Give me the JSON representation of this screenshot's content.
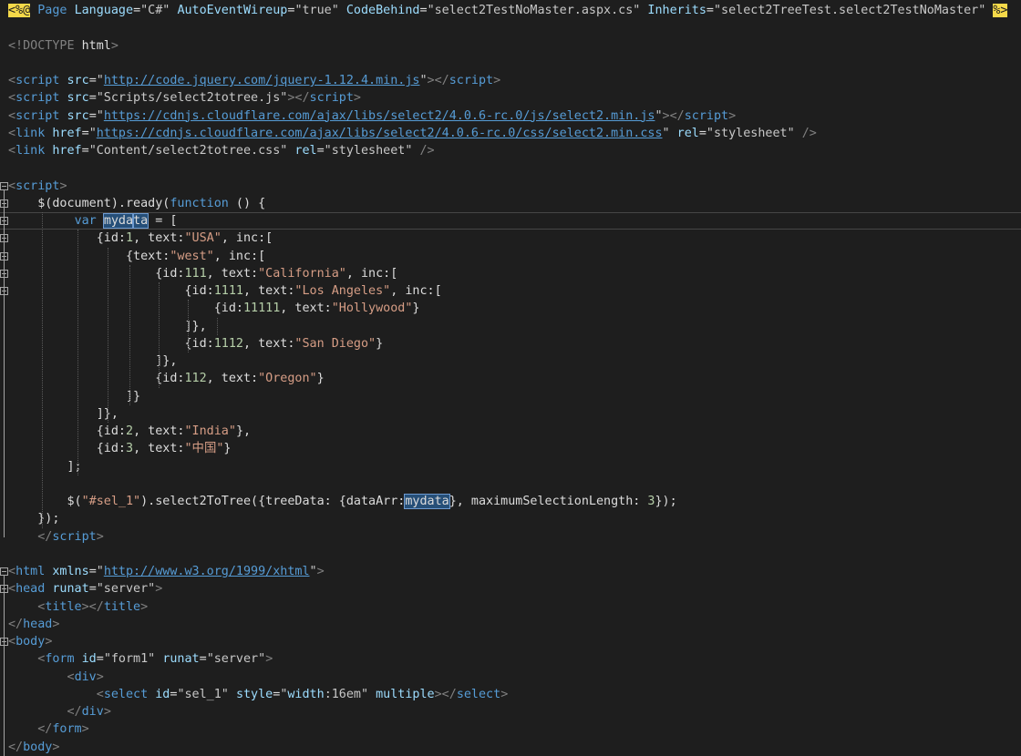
{
  "editor": {
    "lines": [
      [
        [
          "dir",
          "<%@"
        ],
        [
          "txt",
          " "
        ],
        [
          "tag",
          "Page"
        ],
        [
          "txt",
          " "
        ],
        [
          "attr",
          "Language"
        ],
        [
          "txt",
          "="
        ],
        [
          "val",
          "\"C#\""
        ],
        [
          "txt",
          " "
        ],
        [
          "attr",
          "AutoEventWireup"
        ],
        [
          "txt",
          "="
        ],
        [
          "val",
          "\"true\""
        ],
        [
          "txt",
          " "
        ],
        [
          "attr",
          "CodeBehind"
        ],
        [
          "txt",
          "="
        ],
        [
          "val",
          "\"select2TestNoMaster.aspx.cs\""
        ],
        [
          "txt",
          " "
        ],
        [
          "attr",
          "Inherits"
        ],
        [
          "txt",
          "="
        ],
        [
          "val",
          "\"select2TreeTest.select2TestNoMaster\""
        ],
        [
          "txt",
          " "
        ],
        [
          "dir",
          "%>"
        ]
      ],
      [],
      [
        [
          "delim",
          "<!"
        ],
        [
          "doc",
          "DOCTYPE"
        ],
        [
          "txt",
          " "
        ],
        [
          "html",
          "html"
        ],
        [
          "delim",
          ">"
        ]
      ],
      [],
      [
        [
          "delim",
          "<"
        ],
        [
          "tag",
          "script"
        ],
        [
          "txt",
          " "
        ],
        [
          "attr",
          "src"
        ],
        [
          "txt",
          "="
        ],
        [
          "val",
          "\""
        ],
        [
          "url",
          "http://code.jquery.com/jquery-1.12.4.min.js"
        ],
        [
          "val",
          "\""
        ],
        [
          "delim",
          "></"
        ],
        [
          "tag",
          "script"
        ],
        [
          "delim",
          ">"
        ]
      ],
      [
        [
          "delim",
          "<"
        ],
        [
          "tag",
          "script"
        ],
        [
          "txt",
          " "
        ],
        [
          "attr",
          "src"
        ],
        [
          "txt",
          "="
        ],
        [
          "val",
          "\"Scripts/select2totree.js\""
        ],
        [
          "delim",
          "></"
        ],
        [
          "tag",
          "script"
        ],
        [
          "delim",
          ">"
        ]
      ],
      [
        [
          "delim",
          "<"
        ],
        [
          "tag",
          "script"
        ],
        [
          "txt",
          " "
        ],
        [
          "attr",
          "src"
        ],
        [
          "txt",
          "="
        ],
        [
          "val",
          "\""
        ],
        [
          "url",
          "https://cdnjs.cloudflare.com/ajax/libs/select2/4.0.6-rc.0/js/select2.min.js"
        ],
        [
          "val",
          "\""
        ],
        [
          "delim",
          "></"
        ],
        [
          "tag",
          "script"
        ],
        [
          "delim",
          ">"
        ]
      ],
      [
        [
          "delim",
          "<"
        ],
        [
          "tag",
          "link"
        ],
        [
          "txt",
          " "
        ],
        [
          "attr",
          "href"
        ],
        [
          "txt",
          "="
        ],
        [
          "val",
          "\""
        ],
        [
          "url",
          "https://cdnjs.cloudflare.com/ajax/libs/select2/4.0.6-rc.0/css/select2.min.css"
        ],
        [
          "val",
          "\""
        ],
        [
          "txt",
          " "
        ],
        [
          "attr",
          "rel"
        ],
        [
          "txt",
          "="
        ],
        [
          "val",
          "\"stylesheet\""
        ],
        [
          "txt",
          " "
        ],
        [
          "delim",
          "/>"
        ]
      ],
      [
        [
          "delim",
          "<"
        ],
        [
          "tag",
          "link"
        ],
        [
          "txt",
          " "
        ],
        [
          "attr",
          "href"
        ],
        [
          "txt",
          "="
        ],
        [
          "val",
          "\"Content/select2totree.css\""
        ],
        [
          "txt",
          " "
        ],
        [
          "attr",
          "rel"
        ],
        [
          "txt",
          "="
        ],
        [
          "val",
          "\"stylesheet\""
        ],
        [
          "txt",
          " "
        ],
        [
          "delim",
          "/>"
        ]
      ],
      [],
      [
        [
          "delim",
          "<"
        ],
        [
          "tag",
          "script"
        ],
        [
          "delim",
          ">"
        ]
      ],
      [
        [
          "txt",
          "    $(document).ready("
        ],
        [
          "kw",
          "function"
        ],
        [
          "txt",
          " () {"
        ]
      ],
      [
        [
          "txt",
          "         "
        ],
        [
          "kw",
          "var"
        ],
        [
          "txt",
          " "
        ],
        [
          "sel",
          "myda"
        ],
        [
          "cursor",
          ""
        ],
        [
          "sel",
          "ta"
        ],
        [
          "txt",
          " = ["
        ]
      ],
      [
        [
          "txt",
          "            {id:"
        ],
        [
          "num",
          "1"
        ],
        [
          "txt",
          ", text:"
        ],
        [
          "str",
          "\"USA\""
        ],
        [
          "txt",
          ", inc:["
        ]
      ],
      [
        [
          "txt",
          "                {text:"
        ],
        [
          "str",
          "\"west\""
        ],
        [
          "txt",
          ", inc:["
        ]
      ],
      [
        [
          "txt",
          "                    {id:"
        ],
        [
          "num",
          "111"
        ],
        [
          "txt",
          ", text:"
        ],
        [
          "str",
          "\"California\""
        ],
        [
          "txt",
          ", inc:["
        ]
      ],
      [
        [
          "txt",
          "                        {id:"
        ],
        [
          "num",
          "1111"
        ],
        [
          "txt",
          ", text:"
        ],
        [
          "str",
          "\"Los Angeles\""
        ],
        [
          "txt",
          ", inc:["
        ]
      ],
      [
        [
          "txt",
          "                            {id:"
        ],
        [
          "num",
          "11111"
        ],
        [
          "txt",
          ", text:"
        ],
        [
          "str",
          "\"Hollywood\""
        ],
        [
          "txt",
          "}"
        ]
      ],
      [
        [
          "txt",
          "                        ]},"
        ]
      ],
      [
        [
          "txt",
          "                        {id:"
        ],
        [
          "num",
          "1112"
        ],
        [
          "txt",
          ", text:"
        ],
        [
          "str",
          "\"San Diego\""
        ],
        [
          "txt",
          "}"
        ]
      ],
      [
        [
          "txt",
          "                    ]},"
        ]
      ],
      [
        [
          "txt",
          "                    {id:"
        ],
        [
          "num",
          "112"
        ],
        [
          "txt",
          ", text:"
        ],
        [
          "str",
          "\"Oregon\""
        ],
        [
          "txt",
          "}"
        ]
      ],
      [
        [
          "txt",
          "                ]}"
        ]
      ],
      [
        [
          "txt",
          "            ]},"
        ]
      ],
      [
        [
          "txt",
          "            {id:"
        ],
        [
          "num",
          "2"
        ],
        [
          "txt",
          ", text:"
        ],
        [
          "str",
          "\"India\""
        ],
        [
          "txt",
          "},"
        ]
      ],
      [
        [
          "txt",
          "            {id:"
        ],
        [
          "num",
          "3"
        ],
        [
          "txt",
          ", text:"
        ],
        [
          "str",
          "\"中国\""
        ],
        [
          "txt",
          "}"
        ]
      ],
      [
        [
          "txt",
          "        ];"
        ]
      ],
      [],
      [
        [
          "txt",
          "        $("
        ],
        [
          "str",
          "\"#sel_1\""
        ],
        [
          "txt",
          ").select2ToTree({treeData: {dataArr:"
        ],
        [
          "sel",
          "mydata"
        ],
        [
          "txt",
          "}, maximumSelectionLength: "
        ],
        [
          "num",
          "3"
        ],
        [
          "txt",
          "});"
        ]
      ],
      [
        [
          "txt",
          "    });"
        ]
      ],
      [
        [
          "txt",
          "    "
        ],
        [
          "delim",
          "</"
        ],
        [
          "tag",
          "script"
        ],
        [
          "delim",
          ">"
        ]
      ],
      [],
      [
        [
          "delim",
          "<"
        ],
        [
          "tag",
          "html"
        ],
        [
          "txt",
          " "
        ],
        [
          "attr",
          "xmlns"
        ],
        [
          "txt",
          "="
        ],
        [
          "val",
          "\""
        ],
        [
          "url",
          "http://www.w3.org/1999/xhtml"
        ],
        [
          "val",
          "\""
        ],
        [
          "delim",
          ">"
        ]
      ],
      [
        [
          "delim",
          "<"
        ],
        [
          "tag",
          "head"
        ],
        [
          "txt",
          " "
        ],
        [
          "attr",
          "runat"
        ],
        [
          "txt",
          "="
        ],
        [
          "val",
          "\"server\""
        ],
        [
          "delim",
          ">"
        ]
      ],
      [
        [
          "txt",
          "    "
        ],
        [
          "delim",
          "<"
        ],
        [
          "tag",
          "title"
        ],
        [
          "delim",
          "></"
        ],
        [
          "tag",
          "title"
        ],
        [
          "delim",
          ">"
        ]
      ],
      [
        [
          "delim",
          "</"
        ],
        [
          "tag",
          "head"
        ],
        [
          "delim",
          ">"
        ]
      ],
      [
        [
          "delim",
          "<"
        ],
        [
          "tag",
          "body"
        ],
        [
          "delim",
          ">"
        ]
      ],
      [
        [
          "txt",
          "    "
        ],
        [
          "delim",
          "<"
        ],
        [
          "tag",
          "form"
        ],
        [
          "txt",
          " "
        ],
        [
          "attr",
          "id"
        ],
        [
          "txt",
          "="
        ],
        [
          "val",
          "\"form1\""
        ],
        [
          "txt",
          " "
        ],
        [
          "attr",
          "runat"
        ],
        [
          "txt",
          "="
        ],
        [
          "val",
          "\"server\""
        ],
        [
          "delim",
          ">"
        ]
      ],
      [
        [
          "txt",
          "        "
        ],
        [
          "delim",
          "<"
        ],
        [
          "tag",
          "div"
        ],
        [
          "delim",
          ">"
        ]
      ],
      [
        [
          "txt",
          "            "
        ],
        [
          "delim",
          "<"
        ],
        [
          "tag",
          "select"
        ],
        [
          "txt",
          " "
        ],
        [
          "attr",
          "id"
        ],
        [
          "txt",
          "="
        ],
        [
          "val",
          "\"sel_1\""
        ],
        [
          "txt",
          " "
        ],
        [
          "attr",
          "style"
        ],
        [
          "txt",
          "="
        ],
        [
          "val",
          "\""
        ],
        [
          "attr",
          "width"
        ],
        [
          "val",
          ":16em\""
        ],
        [
          "txt",
          " "
        ],
        [
          "attr",
          "multiple"
        ],
        [
          "delim",
          "></"
        ],
        [
          "tag",
          "select"
        ],
        [
          "delim",
          ">"
        ]
      ],
      [
        [
          "txt",
          "        "
        ],
        [
          "delim",
          "</"
        ],
        [
          "tag",
          "div"
        ],
        [
          "delim",
          ">"
        ]
      ],
      [
        [
          "txt",
          "    "
        ],
        [
          "delim",
          "</"
        ],
        [
          "tag",
          "form"
        ],
        [
          "delim",
          ">"
        ]
      ],
      [
        [
          "delim",
          "</"
        ],
        [
          "tag",
          "body"
        ],
        [
          "delim",
          ">"
        ]
      ]
    ],
    "current_line": 12,
    "fold_markers": [
      10,
      11,
      12,
      13,
      14,
      15,
      16,
      32,
      33,
      36
    ],
    "colors": {
      "background": "#1e1e1e",
      "tag": "#569cd6",
      "attribute": "#9cdcfe",
      "string": "#d69d85",
      "number": "#b5cea8",
      "directive_bg": "#f5d949",
      "selection": "#264f78"
    }
  }
}
